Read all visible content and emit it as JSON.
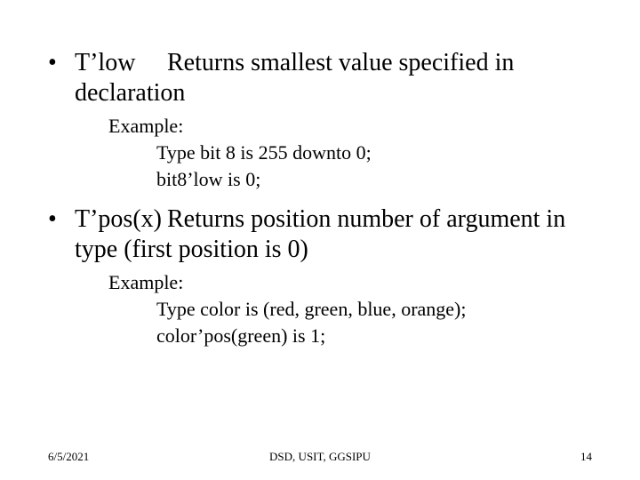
{
  "bullets": [
    {
      "term": "T’low",
      "desc": "Returns smallest value specified in declaration",
      "example_label": "Example:",
      "example_lines": [
        "Type bit 8 is 255 downto 0;",
        "bit8’low is 0;"
      ]
    },
    {
      "term": "T’pos(x)",
      "desc": "Returns position number of argument in type (first position is 0)",
      "example_label": "Example:",
      "example_lines": [
        "Type color is (red, green, blue, orange);",
        "color’pos(green) is 1;"
      ]
    }
  ],
  "footer": {
    "date": "6/5/2021",
    "center": "DSD, USIT, GGSIPU",
    "page": "14"
  }
}
